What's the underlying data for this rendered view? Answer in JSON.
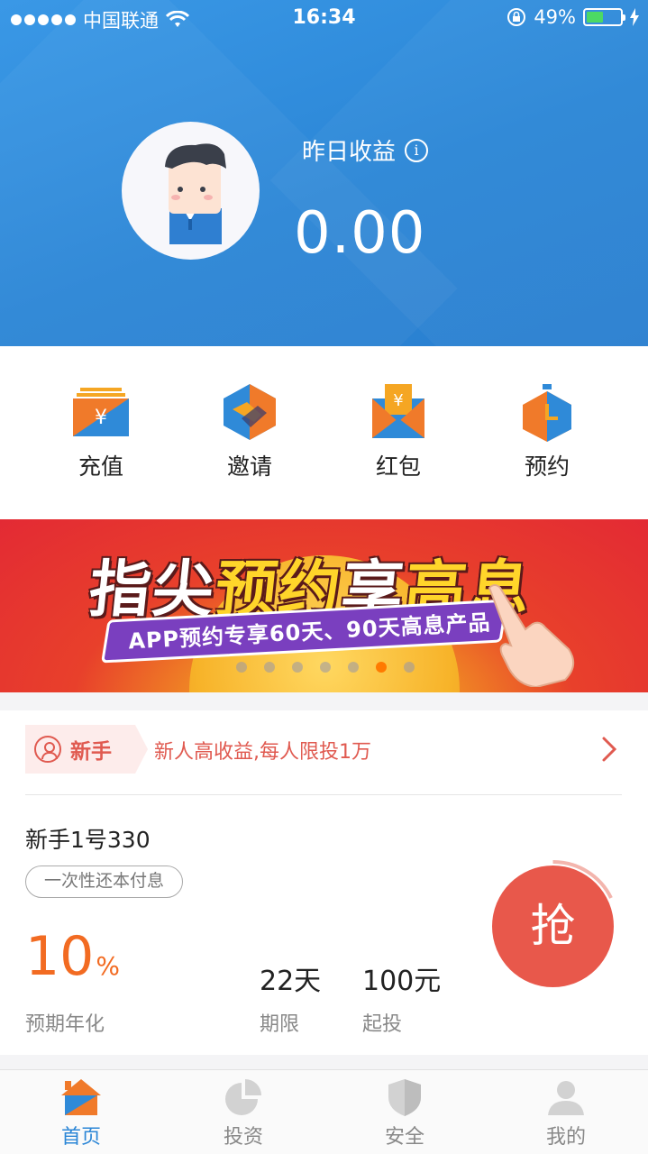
{
  "status_bar": {
    "carrier": "中国联通",
    "time": "16:34",
    "battery": "49%",
    "battery_level": 0.49
  },
  "header": {
    "earnings_label": "昨日收益",
    "info_glyph": "i",
    "earnings_value": "0.00",
    "bg_color": "#2b86d6"
  },
  "quick_actions": [
    {
      "label": "充值",
      "icon": "recharge-icon"
    },
    {
      "label": "邀请",
      "icon": "handshake-icon"
    },
    {
      "label": "红包",
      "icon": "red-envelope-icon"
    },
    {
      "label": "预约",
      "icon": "stopwatch-icon"
    }
  ],
  "banner": {
    "title_part1": "指尖",
    "title_part2": "预约",
    "title_part3": "享",
    "title_part4": "高息",
    "subtitle": "APP预约专享60天、90天高息产品",
    "dot_count": 7,
    "active_dot": 5
  },
  "product": {
    "tag": "新手",
    "promo": "新人高收益,每人限投1万",
    "name": "新手1号330",
    "repayment": "一次性还本付息",
    "rate_value": "10",
    "rate_unit": "%",
    "rate_label": "预期年化",
    "term_value": "22天",
    "term_label": "期限",
    "min_value": "100元",
    "min_label": "起投",
    "grab_label": "抢",
    "accent_color": "#f26b22",
    "tag_color": "#e05a50"
  },
  "tab_bar": [
    {
      "label": "首页",
      "icon": "home-icon",
      "active": true
    },
    {
      "label": "投资",
      "icon": "pie-chart-icon",
      "active": false
    },
    {
      "label": "安全",
      "icon": "shield-icon",
      "active": false
    },
    {
      "label": "我的",
      "icon": "user-icon",
      "active": false
    }
  ]
}
